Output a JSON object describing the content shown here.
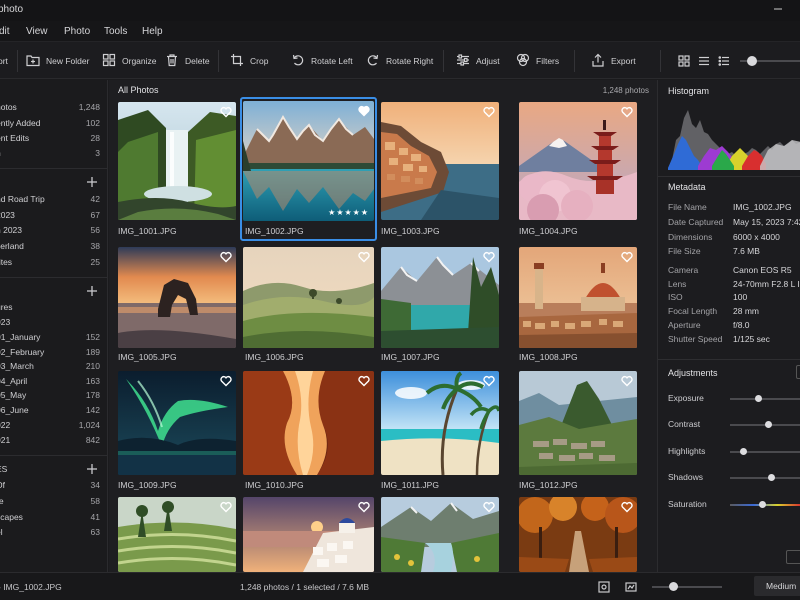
{
  "window": {
    "title": "photo"
  },
  "menu": [
    "dit",
    "View",
    "Photo",
    "Tools",
    "Help"
  ],
  "toolbar": {
    "import_label": "ort",
    "new_folder_label": "New Folder",
    "organize_label": "Organize",
    "delete_label": "Delete",
    "crop_label": "Crop",
    "rotate_left_label": "Rotate Left",
    "rotate_right_label": "Rotate Right",
    "adjust_label": "Adjust",
    "filters_label": "Filters",
    "export_label": "Export"
  },
  "sidebar": {
    "library": [
      {
        "label": "hotos",
        "count": "1,248"
      },
      {
        "label": "ently Added",
        "count": "102"
      },
      {
        "label": "ent Edits",
        "count": "28"
      },
      {
        "label": "h",
        "count": "3"
      }
    ],
    "albums": [
      {
        "label": "nd Road Trip",
        "count": "42"
      },
      {
        "label": "2023",
        "count": "67"
      },
      {
        "label": "n 2023",
        "count": "56"
      },
      {
        "label": "zerland",
        "count": "38"
      },
      {
        "label": "rites",
        "count": "25"
      }
    ],
    "folders": [
      {
        "label": "ures",
        "count": ""
      },
      {
        "label": "023",
        "count": ""
      },
      {
        "label": "01_January",
        "count": "152"
      },
      {
        "label": "02_February",
        "count": "189"
      },
      {
        "label": "03_March",
        "count": "210"
      },
      {
        "label": "04_April",
        "count": "163"
      },
      {
        "label": "05_May",
        "count": "178"
      },
      {
        "label": "06_June",
        "count": "142"
      },
      {
        "label": "022",
        "count": "1,024"
      },
      {
        "label": "021",
        "count": "842"
      }
    ],
    "tags": [
      {
        "label": "ES",
        "count": ""
      },
      {
        "label": "Of",
        "count": "34"
      },
      {
        "label": "re",
        "count": "58"
      },
      {
        "label": "scapes",
        "count": "41"
      },
      {
        "label": "el",
        "count": "63"
      }
    ]
  },
  "main": {
    "title": "All Photos",
    "count": "1,248 photos",
    "photos": [
      {
        "name": "IMG_1001.JPG",
        "favorite": false
      },
      {
        "name": "IMG_1002.JPG",
        "favorite": true,
        "selected": true,
        "rating": "★★★★★"
      },
      {
        "name": "IMG_1003.JPG",
        "favorite": false
      },
      {
        "name": "IMG_1004.JPG",
        "favorite": false
      },
      {
        "name": "IMG_1005.JPG",
        "favorite": false
      },
      {
        "name": "IMG_1006.JPG",
        "favorite": false
      },
      {
        "name": "IMG_1007.JPG",
        "favorite": false
      },
      {
        "name": "IMG_1008.JPG",
        "favorite": false
      },
      {
        "name": "IMG_1009.JPG",
        "favorite": false
      },
      {
        "name": "IMG_1010.JPG",
        "favorite": false
      },
      {
        "name": "IMG_1011.JPG",
        "favorite": false
      },
      {
        "name": "IMG_1012.JPG",
        "favorite": false
      },
      {
        "name": "",
        "favorite": false
      },
      {
        "name": "",
        "favorite": false
      },
      {
        "name": "",
        "favorite": false
      },
      {
        "name": "",
        "favorite": false
      }
    ]
  },
  "right_panel": {
    "histogram_title": "Histogram",
    "metadata_title": "Metadata",
    "metadata": [
      {
        "key": "File Name",
        "value": "IMG_1002.JPG"
      },
      {
        "key": "Date Captured",
        "value": "May 15, 2023 7:42"
      },
      {
        "key": "Dimensions",
        "value": "6000 x 4000"
      },
      {
        "key": "File Size",
        "value": "7.6 MB"
      },
      {
        "key": "Camera",
        "value": "Canon EOS R5"
      },
      {
        "key": "Lens",
        "value": "24-70mm F2.8 L IS"
      },
      {
        "key": "ISO",
        "value": "100"
      },
      {
        "key": "Focal Length",
        "value": "28 mm"
      },
      {
        "key": "Aperture",
        "value": "f/8.0"
      },
      {
        "key": "Shutter Speed",
        "value": "1/125 sec"
      }
    ],
    "adjustments_title": "Adjustments",
    "adjustments": [
      {
        "label": "Exposure",
        "value": 0.5
      },
      {
        "label": "Contrast",
        "value": 0.65
      },
      {
        "label": "Highlights",
        "value": 0.2
      },
      {
        "label": "Shadows",
        "value": 0.58
      },
      {
        "label": "Saturation",
        "value": 0.5
      }
    ]
  },
  "status": {
    "left": "- IMG_1002.JPG",
    "middle": "1,248 photos / 1 selected / 7.6 MB",
    "quality": "Medium"
  },
  "colors": {
    "accent": "#3a8ee6",
    "background": "#1b1b1d"
  }
}
